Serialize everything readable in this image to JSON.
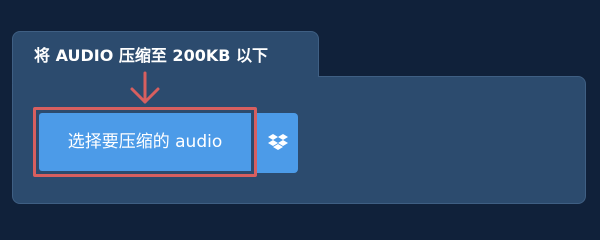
{
  "tab": {
    "title": "将 AUDIO 压缩至 200KB 以下"
  },
  "upload": {
    "choose_label": "选择要压缩的 audio"
  },
  "icons": {
    "pointer": "down-arrow-icon",
    "cloud": "dropbox-icon"
  },
  "colors": {
    "page_background": "#10213a",
    "panel": "#2c4b6e",
    "button": "#4c9be8",
    "highlight": "#d85f5f"
  }
}
